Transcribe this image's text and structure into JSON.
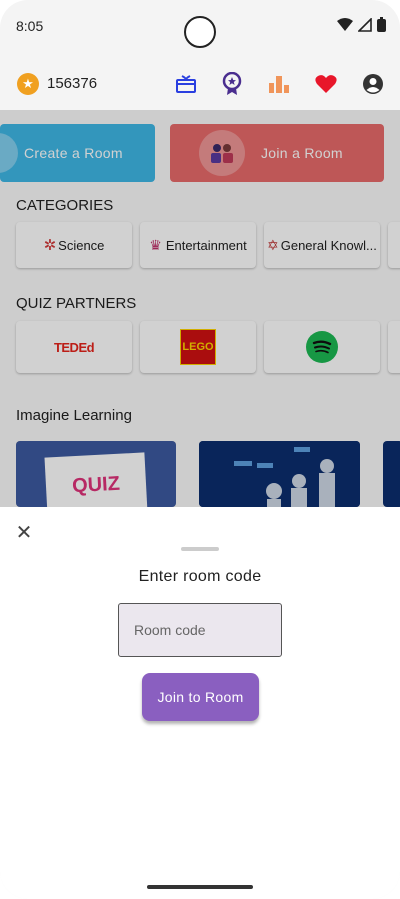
{
  "status": {
    "time": "8:05"
  },
  "topbar": {
    "coins": "156376",
    "icons": [
      "gift-icon",
      "badge-icon",
      "leaderboard-icon",
      "heart-icon",
      "profile-icon"
    ],
    "colors": {
      "coin": "#f0a020",
      "gift": "#2a3fe0",
      "badge": "#4a2e8f",
      "leaderboard": "#f0955a",
      "heart": "#e8162a",
      "profile": "#333333"
    }
  },
  "actions": {
    "create_label": "Create a Room",
    "join_label": "Join a Room"
  },
  "categories": {
    "title": "CATEGORIES",
    "items": [
      "Science",
      "Entertainment",
      "General Knowl..."
    ]
  },
  "partners": {
    "title": "QUIZ PARTNERS",
    "items": [
      "TED-Ed",
      "LEGO",
      "Spotify"
    ],
    "ted_label": "TEDEd",
    "lego_label": "LEGO"
  },
  "learning": {
    "title": "Imagine Learning",
    "quiz_label": "QUIZ"
  },
  "sheet": {
    "title": "Enter room code",
    "input_placeholder": "Room code",
    "button_label": "Join to Room"
  }
}
